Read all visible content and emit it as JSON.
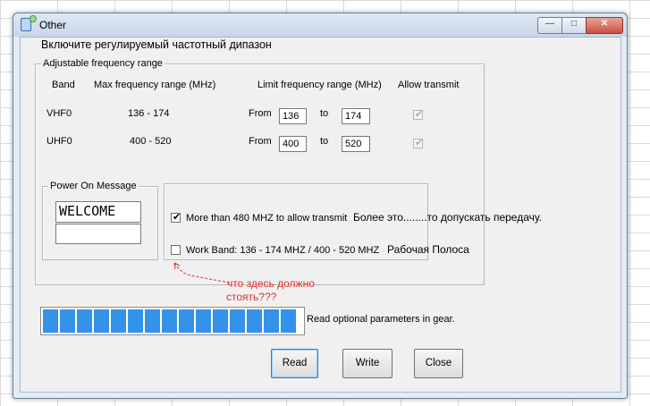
{
  "window": {
    "title": "Other"
  },
  "heading": "Включите регулируемый частотный дипазон",
  "freq_group": {
    "legend": "Adjustable  frequency  range",
    "columns": {
      "band": "Band",
      "max": "Max frequency range (MHz)",
      "limit": "Limit frequency range (MHz)",
      "allow": "Allow transmit"
    },
    "rows": [
      {
        "band": "VHF0",
        "max": "136 - 174",
        "from_label": "From",
        "from": "136",
        "to_label": "to",
        "to": "174",
        "allow": true
      },
      {
        "band": "UHF0",
        "max": "400 - 520",
        "from_label": "From",
        "from": "400",
        "to_label": "to",
        "to": "520",
        "allow": true
      }
    ]
  },
  "power_group": {
    "legend": "Power On Message",
    "line1": "WELCOME",
    "line2": ""
  },
  "options": {
    "more_than_480": {
      "label": "More than 480 MHZ to allow transmit",
      "checked": true,
      "note": "Более это........то допускать передачу."
    },
    "work_band": {
      "label": "Work Band: 136 - 174 MHZ / 400 - 520 MHZ",
      "checked": false,
      "note": "Рабочая Полоса"
    }
  },
  "annotation": {
    "line1": "что здесь должно",
    "line2": "стоять???"
  },
  "progress": {
    "segments": 15,
    "status": "Read optional parameters in gear."
  },
  "buttons": {
    "read": "Read",
    "write": "Write",
    "close": "Close"
  },
  "colors": {
    "progress": "#3393ea",
    "annotation": "#e0302b"
  }
}
